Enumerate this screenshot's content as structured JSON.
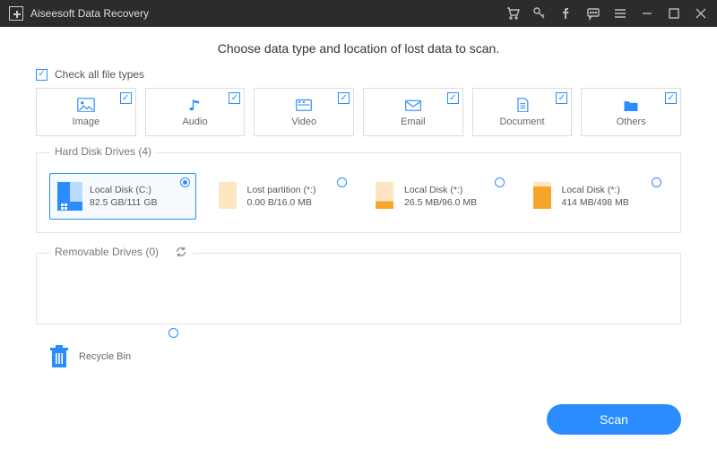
{
  "app": {
    "title": "Aiseesoft Data Recovery"
  },
  "heading": "Choose data type and location of lost data to scan.",
  "check_all_label": "Check all file types",
  "types": [
    {
      "label": "Image"
    },
    {
      "label": "Audio"
    },
    {
      "label": "Video"
    },
    {
      "label": "Email"
    },
    {
      "label": "Document"
    },
    {
      "label": "Others"
    }
  ],
  "hdd": {
    "legend": "Hard Disk Drives (4)",
    "drives": [
      {
        "name": "Local Disk (C:)",
        "size": "82.5 GB/111 GB",
        "selected": true,
        "fill": 0.74,
        "color": "#2a8cff",
        "light": "#bcdcff",
        "system": true
      },
      {
        "name": "Lost partition (*:)",
        "size": "0.00  B/16.0 MB",
        "selected": false,
        "fill": 0.0,
        "color": "#f7a52a",
        "light": "#ffe6c2",
        "system": false
      },
      {
        "name": "Local Disk (*:)",
        "size": "26.5 MB/96.0 MB",
        "selected": false,
        "fill": 0.28,
        "color": "#f7a52a",
        "light": "#ffe6c2",
        "system": false
      },
      {
        "name": "Local Disk (*:)",
        "size": "414 MB/498 MB",
        "selected": false,
        "fill": 0.83,
        "color": "#f7a52a",
        "light": "#ffe6c2",
        "system": false
      }
    ]
  },
  "removable": {
    "legend": "Removable Drives (0)"
  },
  "recycle": {
    "label": "Recycle Bin"
  },
  "scan_label": "Scan"
}
